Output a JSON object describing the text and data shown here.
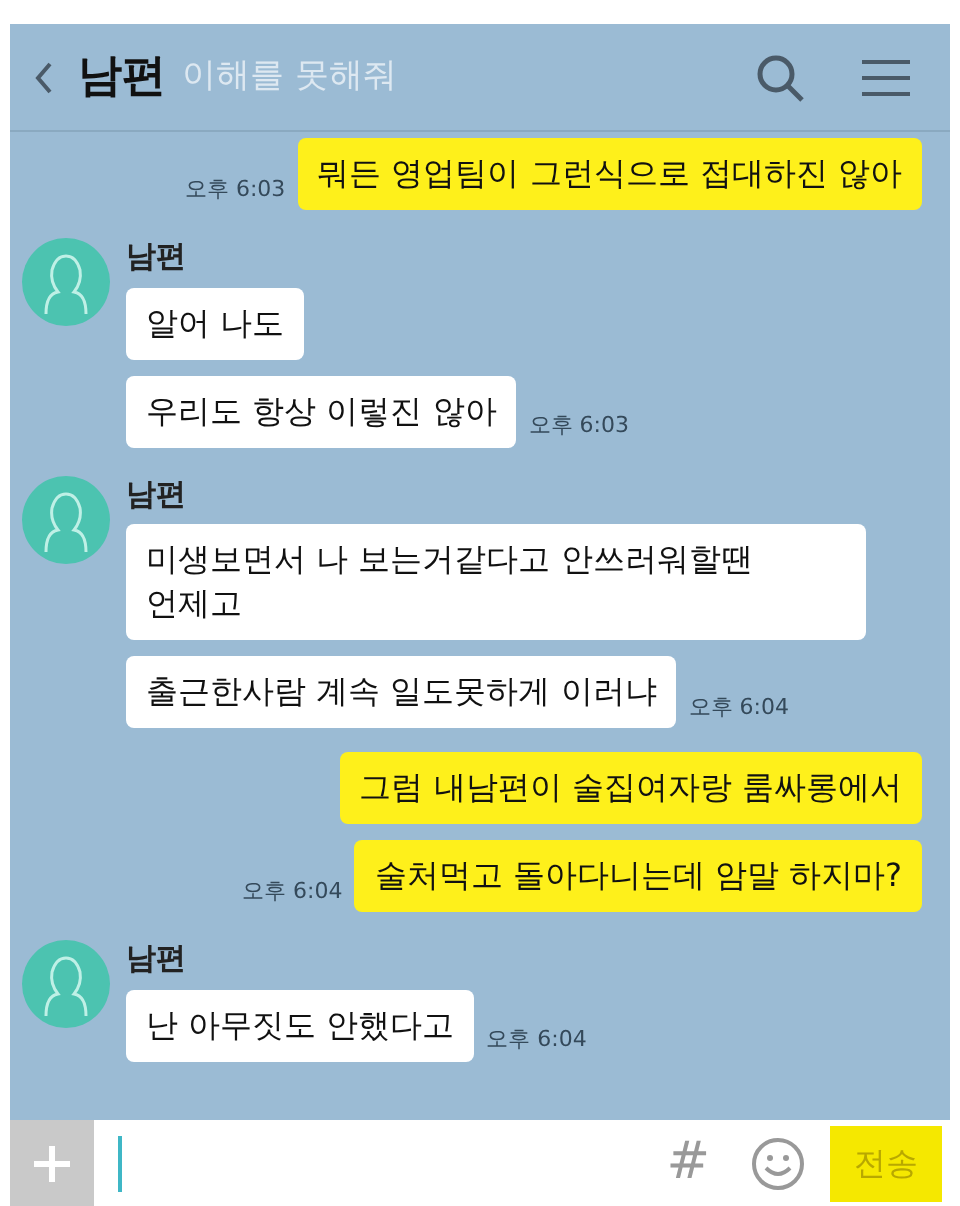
{
  "header": {
    "title": "남편",
    "overlay_text": "이해를 못해줘"
  },
  "messages": [
    {
      "kind": "sent",
      "bubbles": [
        "뭐든 영업팀이 그런식으로 접대하진 않아"
      ],
      "time": "오후 6:03"
    },
    {
      "kind": "received",
      "sender": "남편",
      "bubbles": [
        "알어 나도",
        "우리도 항상 이렇진 않아"
      ],
      "time": "오후 6:03"
    },
    {
      "kind": "received",
      "sender": "남편",
      "bubbles": [
        "미생보면서 나 보는거같다고 안쓰러워할땐 언제고",
        "출근한사람 계속 일도못하게 이러냐"
      ],
      "time": "오후 6:04"
    },
    {
      "kind": "sent",
      "bubbles": [
        "그럼 내남편이 술집여자랑 룸싸롱에서",
        "술처먹고 돌아다니는데 암말 하지마?"
      ],
      "time": "오후 6:04"
    },
    {
      "kind": "received",
      "sender": "남편",
      "bubbles": [
        "난 아무짓도 안했다고"
      ],
      "time": "오후 6:04"
    }
  ],
  "input_bar": {
    "hash": "#",
    "send": "전송"
  }
}
